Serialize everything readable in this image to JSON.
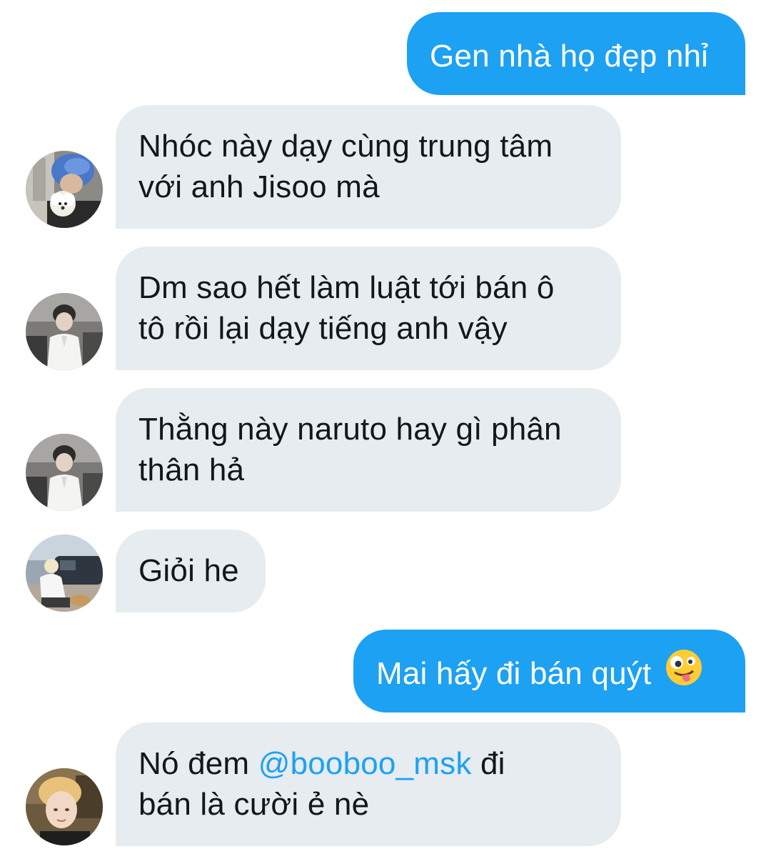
{
  "messages": [
    {
      "id": 1,
      "direction": "outgoing",
      "lines": [
        "Gen nhà họ đẹp nhỉ"
      ]
    },
    {
      "id": 2,
      "direction": "incoming",
      "avatar": "avatar-blue-hair-dog",
      "lines": [
        "Nhóc này dạy cùng trung tâm",
        "với anh Jisoo mà"
      ]
    },
    {
      "id": 3,
      "direction": "incoming",
      "avatar": "avatar-white-shirt",
      "lines": [
        "Dm sao hết làm luật tới bán ô",
        "tô rồi lại dạy tiếng anh vậy"
      ]
    },
    {
      "id": 4,
      "direction": "incoming",
      "avatar": "avatar-white-shirt",
      "lines": [
        "Thằng này naruto hay gì phân",
        "thân hả"
      ]
    },
    {
      "id": 5,
      "direction": "incoming",
      "avatar": "avatar-car-street",
      "lines": [
        "Giỏi he"
      ]
    },
    {
      "id": 6,
      "direction": "outgoing",
      "lines": [
        "Mai hấy đi bán quýt"
      ],
      "emoji": "zany-face-emoji"
    },
    {
      "id": 7,
      "direction": "incoming",
      "avatar": "avatar-blonde-selfie",
      "line1_before": "Nó đem ",
      "mention": "@booboo_msk",
      "line1_after": " đi",
      "line2": "bán là cười ẻ nè"
    }
  ],
  "colors": {
    "outgoing_bubble": "#1da1f2",
    "incoming_bubble": "#e6ecf0",
    "incoming_text": "#14171a",
    "mention": "#1da1f2"
  }
}
